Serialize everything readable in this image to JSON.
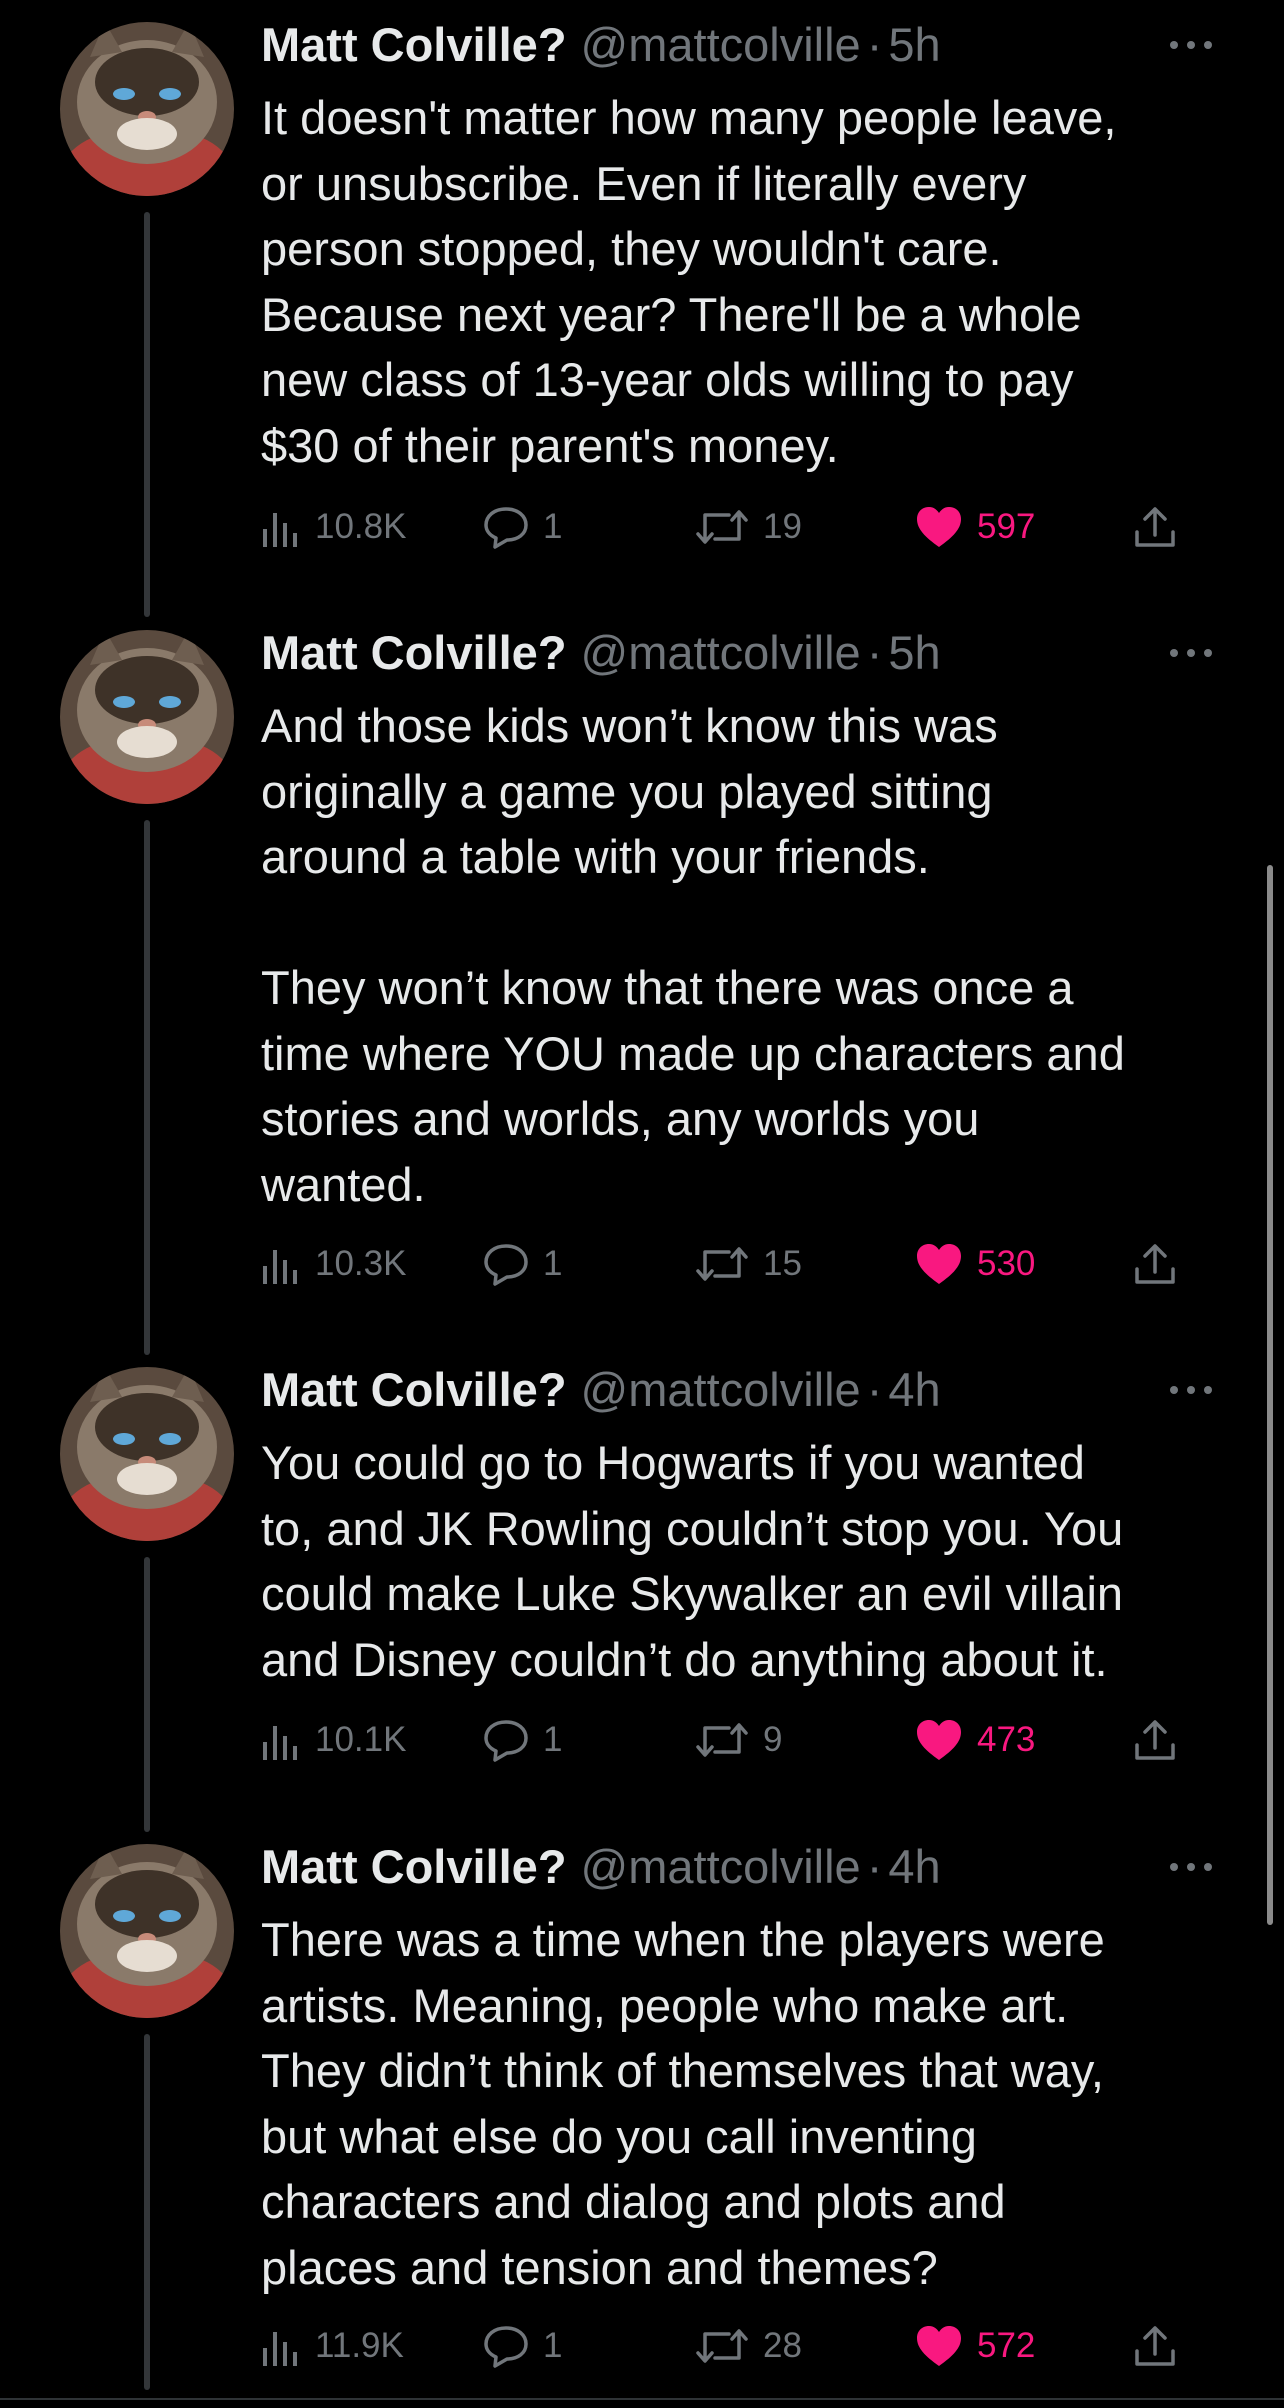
{
  "tweets": [
    {
      "name": "Matt Colville?",
      "handle": "@mattcolville",
      "separator": "·",
      "time": "5h",
      "text": "It doesn't matter how many people leave,\nor unsubscribe. Even if literally every\nperson stopped, they wouldn't care.\nBecause next year? There'll be a whole\nnew class of 13-year olds willing to pay\n$30 of their parent's money.",
      "views": "10.8K",
      "replies": "1",
      "retweets": "19",
      "likes": "597"
    },
    {
      "name": "Matt Colville?",
      "handle": "@mattcolville",
      "separator": "·",
      "time": "5h",
      "text": "And those kids won’t know this was\noriginally a game you played sitting\naround a table with your friends.\n\nThey won’t know that there was once a\ntime where YOU made up characters and\nstories and worlds, any worlds you\nwanted.",
      "views": "10.3K",
      "replies": "1",
      "retweets": "15",
      "likes": "530"
    },
    {
      "name": "Matt Colville?",
      "handle": "@mattcolville",
      "separator": "·",
      "time": "4h",
      "text": "You could go to Hogwarts if you wanted\nto, and JK Rowling couldn’t stop you. You\ncould make Luke Skywalker an evil villain\nand Disney couldn’t do anything about it.",
      "views": "10.1K",
      "replies": "1",
      "retweets": "9",
      "likes": "473"
    },
    {
      "name": "Matt Colville?",
      "handle": "@mattcolville",
      "separator": "·",
      "time": "4h",
      "text": "There was a time when the players were\nartists. Meaning, people who make art.\nThey didn’t think of themselves that way,\nbut what else do you call inventing\ncharacters and dialog and plots and\nplaces and tension and themes?",
      "views": "11.9K",
      "replies": "1",
      "retweets": "28",
      "likes": "572"
    }
  ],
  "icons": {
    "views": "bar-chart-icon",
    "reply": "speech-bubble-icon",
    "retweet": "retweet-icon",
    "like": "heart-filled-icon",
    "share": "share-upload-icon",
    "more": "more-horizontal-icon"
  },
  "colors": {
    "background": "#000000",
    "text": "#e7e9ea",
    "secondary": "#71767b",
    "like": "#f91880",
    "thread_line": "#333639"
  }
}
